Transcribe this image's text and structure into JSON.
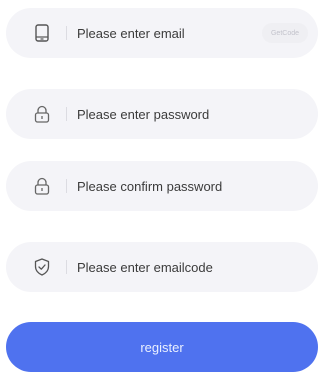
{
  "form": {
    "email": {
      "placeholder": "Please enter email",
      "icon": "phone-icon",
      "getcode_label": "GetCode"
    },
    "password": {
      "placeholder": "Please enter password",
      "icon": "lock-icon"
    },
    "confirm_password": {
      "placeholder": "Please confirm password",
      "icon": "lock-icon"
    },
    "email_code": {
      "placeholder": "Please enter emailcode",
      "icon": "shield-check-icon"
    },
    "register_label": "register"
  },
  "colors": {
    "field_background": "#f4f4f8",
    "accent": "#4f72ef",
    "text": "#3b3b3b"
  }
}
